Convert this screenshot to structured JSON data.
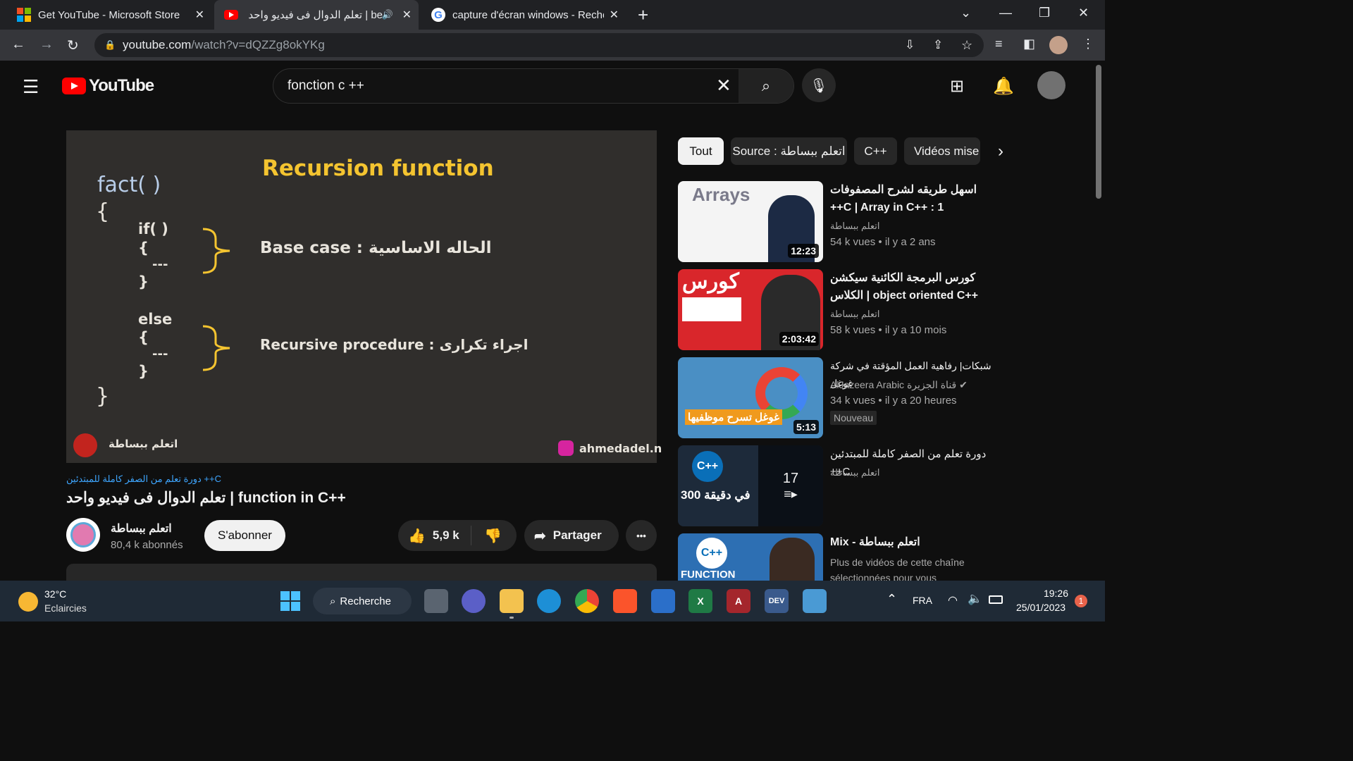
{
  "browser": {
    "tabs": [
      {
        "title": "Get YouTube - Microsoft Store"
      },
      {
        "title": "be | تعلم الدوال فى فيديو واحد"
      },
      {
        "title": "capture d'écran windows - Reche"
      }
    ],
    "url_host": "youtube.com",
    "url_path": "/watch?v=dQZZg8okYKg",
    "new_tab": "+"
  },
  "youtube": {
    "logo_text": "YouTube",
    "search_query": "fonction c ++"
  },
  "video": {
    "slide": {
      "title": "Recursion function",
      "code_head": "fact( )",
      "brace_open": "{",
      "if_line": "if( )",
      "inner_open": "{",
      "dashes": "---",
      "inner_close": "}",
      "else_line": "else",
      "inner_open2": "{",
      "dashes2": "---",
      "inner_close2": "}",
      "brace_close": "}",
      "base_case": "Base case : الحاله الاساسية",
      "recursive": "Recursive procedure : اجراء تكرارى",
      "watermark_left": "اتعلم ببساطة",
      "watermark_right": "ahmedadel.n"
    },
    "playlist_link": "دورة تعلم من الصفر كاملة للمبتدئين ++C",
    "title": "تعلم الدوال فى فيديو واحد | function in C++",
    "channel_name": "اتعلم ببساطة",
    "subscribers": "80,4 k abonnés",
    "subscribe_label": "S'abonner",
    "likes": "5,9 k",
    "share_label": "Partager",
    "more_label": "•••"
  },
  "chips": [
    "Tout",
    "Source : اتعلم ببساطة",
    "C++",
    "Vidéos mise"
  ],
  "recommendations": [
    {
      "title": "اسهل طريقه لشرح المصفوفات ++C | Array in C++ : 1",
      "channel": "اتعلم ببساطة",
      "views": "54 k vues",
      "age": "il y a 2 ans",
      "duration": "12:23",
      "thumb_text": "Arrays"
    },
    {
      "title": "كورس البرمجة الكائنية سيكشن الكلاس | object oriented C++",
      "channel": "اتعلم ببساطة",
      "views": "58 k vues",
      "age": "il y a 10 mois",
      "duration": "2:03:42",
      "thumb_text": "كورس"
    },
    {
      "title": "شبكات| رفاهية العمل المؤقتة في شركة غوغل",
      "channel": "AlJazeera Arabic قناة الجزيرة",
      "views": "34 k vues",
      "age": "il y a 20 heures",
      "duration": "5:13",
      "badge": "Nouveau",
      "thumb_text": "غوغل تسرح موظفيها"
    },
    {
      "title": "دورة تعلم من الصفر كاملة للمبتدئين ++C",
      "channel": "اتعلم ببساطة",
      "count": "17",
      "thumb_text": "300 في دقيقة"
    },
    {
      "title": "Mix - اتعلم ببساطة",
      "channel": "Plus de vidéos de cette chaîne sélectionnées pour vous",
      "thumb_text": "FUNCTION"
    }
  ],
  "taskbar": {
    "weather_temp": "32°C",
    "weather_desc": "Eclaircies",
    "search_label": "Recherche",
    "language": "FRA",
    "time": "19:26",
    "date": "25/01/2023",
    "notifications": "1"
  },
  "colors": {
    "yt_red": "#ff0000",
    "bg": "#0f0f0f",
    "chalk_yellow": "#f4c430"
  }
}
